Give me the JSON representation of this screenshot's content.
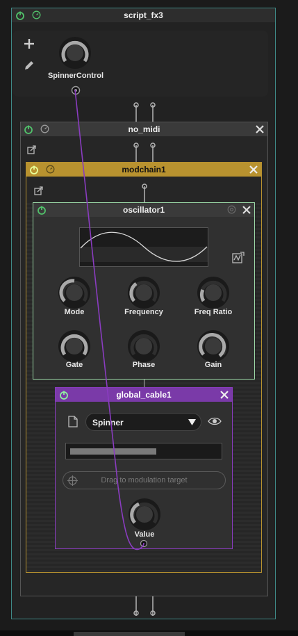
{
  "colors": {
    "bg": "#1b1b1b",
    "script_border": "#3f8a87",
    "script_header": "#2d2d2d",
    "nomidi_header": "#3a3a3a",
    "modchain_header": "#b8922f",
    "osc_border": "#9bd7a6",
    "cable_header": "#7a3aa8",
    "cable_wire": "#8a3cc0",
    "power_green": "#51c26b"
  },
  "script_fx": {
    "title": "script_fx3",
    "add_icon": "plus-icon",
    "edit_icon": "pencil-icon",
    "knob_label": "SpinnerControl"
  },
  "no_midi": {
    "title": "no_midi",
    "popout_icon": "popout-icon"
  },
  "modchain": {
    "title": "modchain1",
    "popout_icon": "popout-icon"
  },
  "oscillator": {
    "title": "oscillator1",
    "knobs": [
      {
        "label": "Mode"
      },
      {
        "label": "Frequency"
      },
      {
        "label": "Freq Ratio"
      },
      {
        "label": "Gate"
      },
      {
        "label": "Phase"
      },
      {
        "label": "Gain"
      }
    ]
  },
  "global_cable": {
    "title": "global_cable1",
    "dropdown_value": "Spinner",
    "drag_placeholder": "Drag to modulation target",
    "value_label": "Value"
  }
}
